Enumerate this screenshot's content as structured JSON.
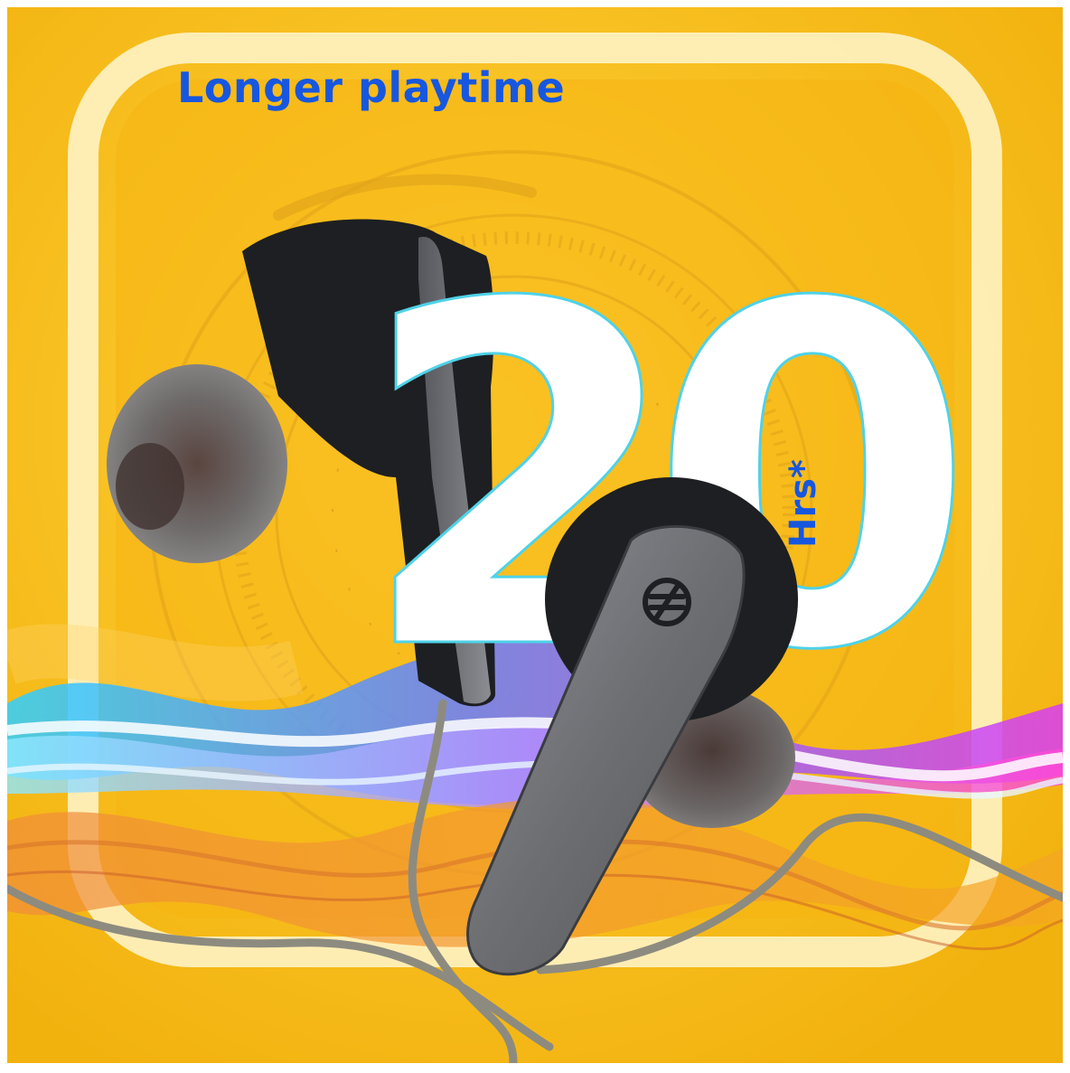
{
  "promo": {
    "headline": "Longer playtime",
    "playtime_value": "20",
    "playtime_unit": "Hrs*"
  },
  "colors": {
    "background": "#f7bf17",
    "headline": "#1757e0",
    "number_fill": "#ffffff",
    "number_outline": "#4fd2e8",
    "earbud_body": "#1d1f22",
    "earbud_stem": "#6e7074",
    "cable": "#8d8b80"
  },
  "icons": {
    "brand_logo": "brand-logo-icon"
  }
}
